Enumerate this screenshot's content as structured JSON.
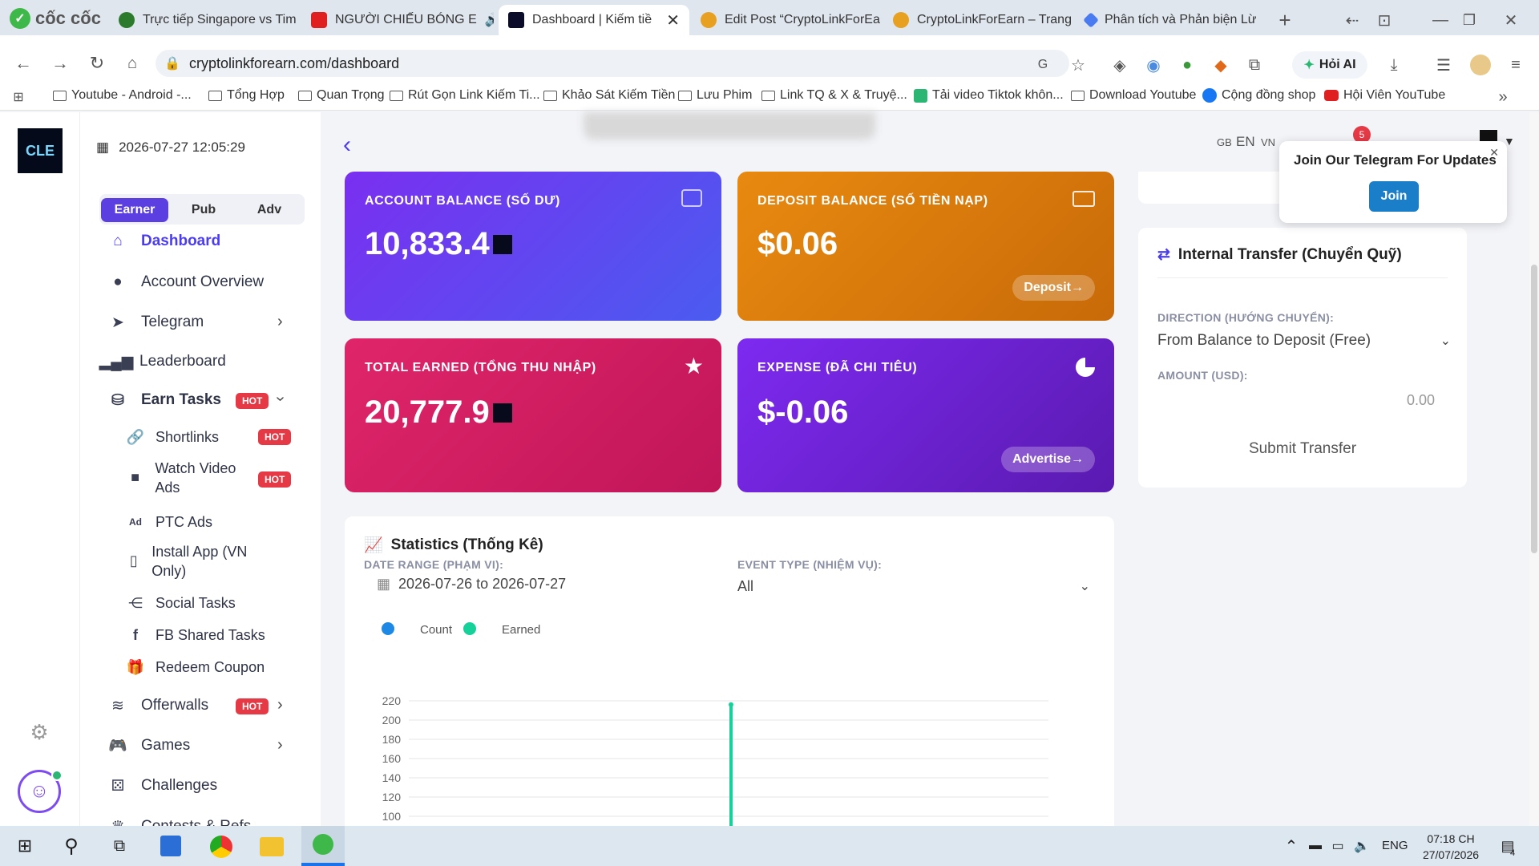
{
  "browser": {
    "brand": "cốc cốc",
    "tabs": [
      {
        "title": "Trực tiếp Singapore vs Tim",
        "color": "#2c7a2c"
      },
      {
        "title": "NGƯỜI CHIẾU BÓNG E",
        "color": "#e02020"
      },
      {
        "title": "Dashboard | Kiếm tiề",
        "color": "#0b0b2a"
      },
      {
        "title": "Edit Post “CryptoLinkForEa",
        "color": "#e8a020"
      },
      {
        "title": "CryptoLinkForEarn – Trang",
        "color": "#e8a020"
      },
      {
        "title": "Phân tích và Phản biện Lừ",
        "color": "#4a7bf0"
      }
    ],
    "url": "cryptolinkforearn.com/dashboard",
    "ask_ai": "Hỏi AI",
    "bookmarks": [
      "Youtube - Android -...",
      "Tổng Hợp",
      "Quan Trọng",
      "Rút Gọn Link Kiếm Ti...",
      "Khảo Sát Kiếm Tiền",
      "Lưu Phim",
      "Link TQ & X & Truyệ...",
      "Tải video Tiktok khôn...",
      "Download Youtube",
      "Cộng đồng shop",
      "Hội Viên YouTube"
    ]
  },
  "app": {
    "logo": "CLE",
    "datetime": "2026-07-27 12:05:29",
    "role_tabs": [
      "Earner",
      "Pub",
      "Adv"
    ],
    "lang": {
      "gb": "GB",
      "en": "EN",
      "vn": "VN"
    },
    "notif_count": "5",
    "nav": {
      "dashboard": "Dashboard",
      "account": "Account Overview",
      "telegram": "Telegram",
      "leaderboard": "Leaderboard",
      "earn_tasks": "Earn Tasks",
      "shortlinks": "Shortlinks",
      "watch_video": "Watch Video Ads",
      "ptc": "PTC Ads",
      "install_app": "Install App (VN Only)",
      "social": "Social Tasks",
      "fb_shared": "FB Shared Tasks",
      "redeem": "Redeem Coupon",
      "offerwalls": "Offerwalls",
      "games": "Games",
      "challenges": "Challenges",
      "contests": "Contests & Refs"
    },
    "hot_label": "HOT",
    "cards": {
      "account_balance": {
        "label": "ACCOUNT BALANCE (SỐ DƯ)",
        "value": "10,833.4"
      },
      "deposit_balance": {
        "label": "DEPOSIT BALANCE (SỐ TIỀN NẠP)",
        "value": "$0.06",
        "button": "Deposit→"
      },
      "total_earned": {
        "label": "TOTAL EARNED (TỔNG THU NHẬP)",
        "value": "20,777.9"
      },
      "expense": {
        "label": "EXPENSE (ĐÃ CHI TIÊU)",
        "value": "$-0.06",
        "button": "Advertise→"
      }
    },
    "telegram_popup": {
      "text": "Join Our Telegram For Updates",
      "button": "Join"
    },
    "transfer": {
      "title": "Internal Transfer (Chuyển Quỹ)",
      "direction_label": "DIRECTION (HƯỚNG CHUYỂN):",
      "direction_value": "From Balance to Deposit (Free)",
      "amount_label": "AMOUNT (USD):",
      "amount_placeholder": "0.00",
      "submit": "Submit Transfer"
    },
    "stats": {
      "title": "Statistics (Thống Kê)",
      "date_label": "DATE RANGE (PHẠM VI):",
      "date_value": "2026-07-26 to 2026-07-27",
      "event_label": "EVENT TYPE (NHIỆM VỤ):",
      "event_value": "All"
    }
  },
  "chart_data": {
    "type": "bar",
    "series": [
      {
        "name": "Count",
        "color": "#1e88e5",
        "values": []
      },
      {
        "name": "Earned",
        "color": "#16d29a",
        "values": [
          216
        ]
      }
    ],
    "yticks": [
      220,
      200,
      180,
      160,
      140,
      120,
      100
    ],
    "ylim": [
      100,
      220
    ],
    "legend": "top-left"
  },
  "taskbar": {
    "lang": "ENG",
    "time": "07:18 CH",
    "date": "27/07/2026",
    "notif": "4"
  }
}
